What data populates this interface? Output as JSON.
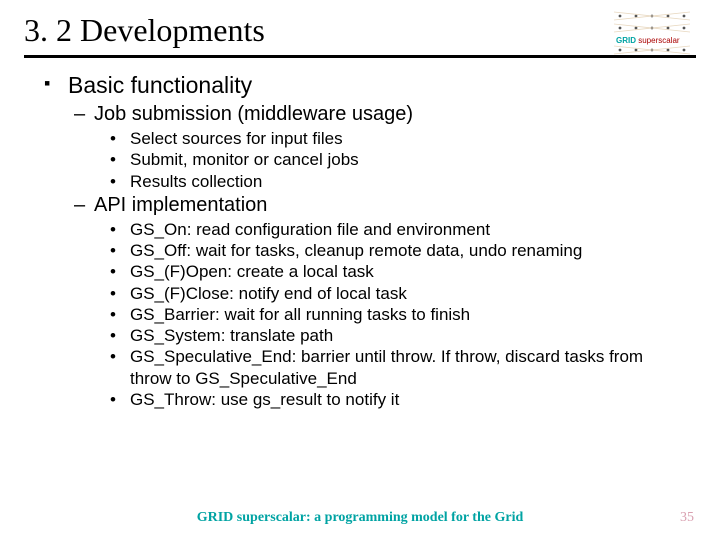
{
  "title": "3. 2 Developments",
  "logo": {
    "label_grid": "GRID",
    "label_super": "superscalar"
  },
  "body": {
    "h1": "Basic functionality",
    "sub1": {
      "heading": "Job submission (middleware usage)",
      "items": [
        "Select sources for input files",
        "Submit, monitor or cancel jobs",
        "Results collection"
      ]
    },
    "sub2": {
      "heading": "API implementation",
      "items": [
        "GS_On: read configuration file and environment",
        "GS_Off: wait for tasks, cleanup remote data, undo renaming",
        "GS_(F)Open: create a local task",
        "GS_(F)Close: notify end of local task",
        "GS_Barrier: wait for all running tasks to finish",
        "GS_System: translate path",
        "GS_Speculative_End: barrier until throw. If throw, discard tasks from throw to GS_Speculative_End",
        "GS_Throw: use gs_result to notify it"
      ]
    }
  },
  "footer": "GRID superscalar: a programming model for the Grid",
  "page": "35"
}
